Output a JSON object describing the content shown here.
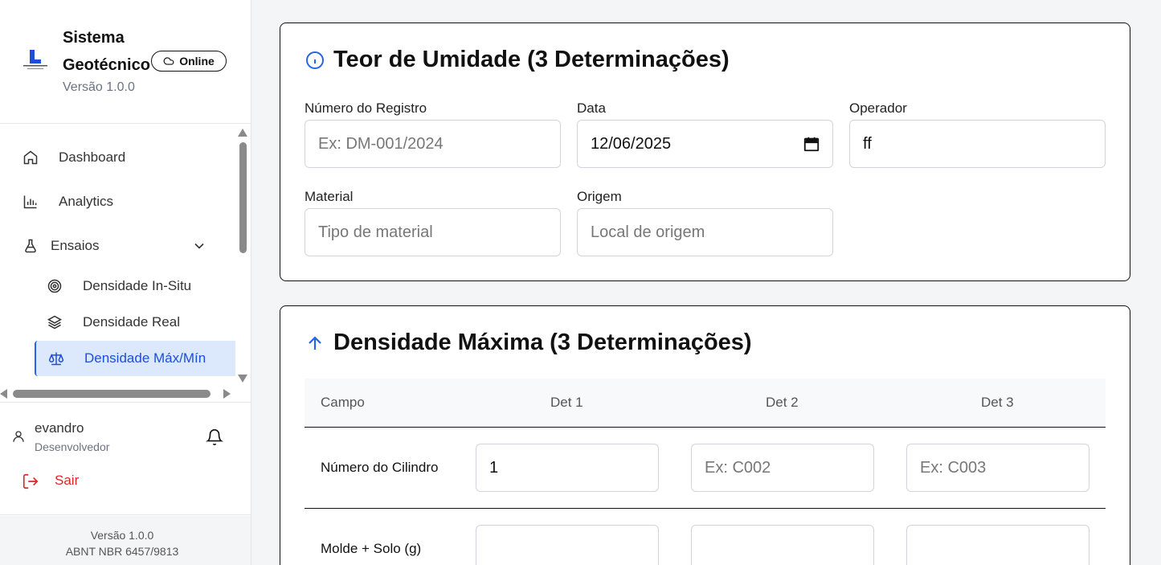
{
  "sidebar": {
    "brand_title": "Sistema Geotécnico",
    "brand_version": "Versão 1.0.0",
    "status_badge": "Online",
    "nav": {
      "dashboard": "Dashboard",
      "analytics": "Analytics",
      "ensaios": "Ensaios",
      "densidade_in_situ": "Densidade In-Situ",
      "densidade_real": "Densidade Real",
      "densidade_max_min": "Densidade Máx/Mín"
    },
    "user": {
      "name": "evandro",
      "role": "Desenvolvedor"
    },
    "logout_label": "Sair",
    "footer": {
      "version": "Versão 1.0.0",
      "standard": "ABNT NBR 6457/9813"
    }
  },
  "umidade_card": {
    "title": "Teor de Umidade (3 Determinações)",
    "registro": {
      "label": "Número do Registro",
      "placeholder": "Ex: DM-001/2024",
      "value": ""
    },
    "data": {
      "label": "Data",
      "value": "12/06/2025"
    },
    "operador": {
      "label": "Operador",
      "value": "ff"
    },
    "material": {
      "label": "Material",
      "placeholder": "Tipo de material",
      "value": ""
    },
    "origem": {
      "label": "Origem",
      "placeholder": "Local de origem",
      "value": ""
    }
  },
  "densidade_card": {
    "title": "Densidade Máxima (3 Determinações)",
    "columns": [
      "Campo",
      "Det 1",
      "Det 2",
      "Det 3"
    ],
    "rows": [
      {
        "label": "Número do Cilindro",
        "values": [
          "1",
          "",
          ""
        ],
        "placeholders": [
          "",
          "Ex: C002",
          "Ex: C003"
        ]
      },
      {
        "label": "Molde + Solo (g)",
        "values": [
          "",
          "",
          ""
        ],
        "placeholders": [
          "",
          "",
          ""
        ]
      }
    ]
  },
  "colors": {
    "accent": "#2563eb",
    "active_bg": "#dce8fb",
    "danger": "#dc2626"
  },
  "icons": [
    "home-icon",
    "bar-chart-icon",
    "flask-icon",
    "chevron-down-icon",
    "target-icon",
    "layers-icon",
    "scale-icon",
    "cloud-icon",
    "user-icon",
    "bell-icon",
    "logout-icon",
    "info-icon",
    "arrow-up-icon",
    "calendar-icon"
  ]
}
